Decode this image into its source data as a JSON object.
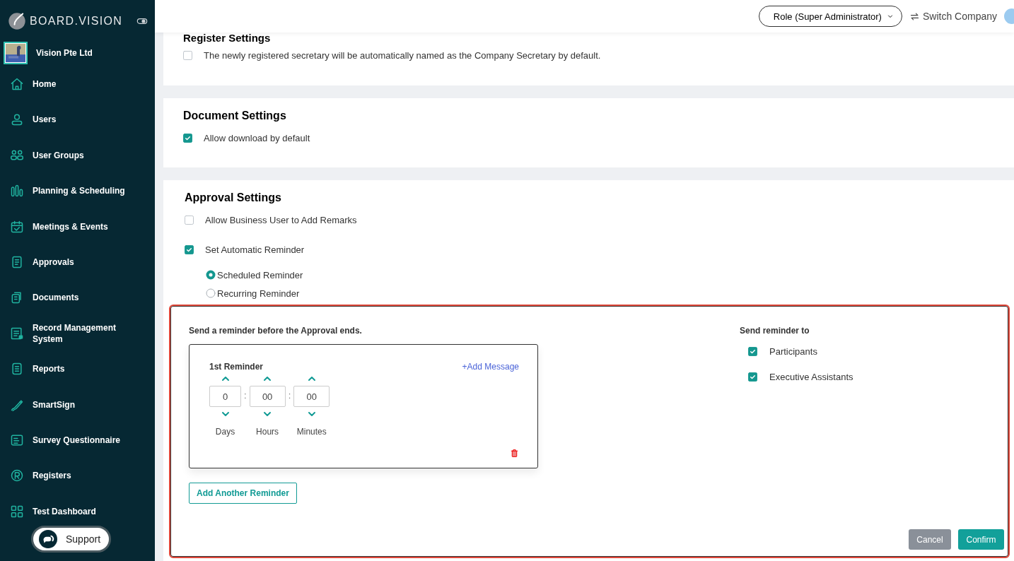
{
  "sidebar": {
    "logo": "BOARD.VISION",
    "company": "Vision Pte Ltd",
    "items": [
      {
        "label": "Home"
      },
      {
        "label": "Users"
      },
      {
        "label": "User Groups"
      },
      {
        "label": "Planning & Scheduling"
      },
      {
        "label": "Meetings & Events"
      },
      {
        "label": "Approvals"
      },
      {
        "label": "Documents"
      },
      {
        "label": "Record Management System"
      },
      {
        "label": "Reports"
      },
      {
        "label": "SmartSign"
      },
      {
        "label": "Survey Questionnaire"
      },
      {
        "label": "Registers"
      },
      {
        "label": "Test Dashboard"
      }
    ],
    "support": "Support"
  },
  "header": {
    "role": "Role (Super Administrator)",
    "switch_company": "Switch Company"
  },
  "sections": [
    {
      "title": "Register Settings",
      "options": [
        {
          "label": "The newly registered secretary will be automatically named as the Company Secretary by default.",
          "checked": false
        }
      ]
    },
    {
      "title": "Document Settings",
      "options": [
        {
          "label": "Allow download by default",
          "checked": true
        }
      ]
    },
    {
      "title": "Approval Settings",
      "options": [
        {
          "label": "Allow Business User to Add Remarks",
          "checked": false
        },
        {
          "label": "Set Automatic Reminder",
          "checked": true
        }
      ],
      "radios": [
        {
          "label": "Scheduled Reminder",
          "selected": true
        },
        {
          "label": "Recurring Reminder",
          "selected": false
        }
      ],
      "reminder_panel": {
        "heading": "Send a reminder before the Approval ends.",
        "reminders": [
          {
            "title": "1st Reminder",
            "add_message": "+Add Message",
            "separator": ":",
            "fields": [
              {
                "value": "0",
                "unit": "Days"
              },
              {
                "value": "00",
                "unit": "Hours"
              },
              {
                "value": "00",
                "unit": "Minutes"
              }
            ]
          }
        ],
        "add_button": "Add Another Reminder",
        "recipients_title": "Send reminder to",
        "recipients": [
          {
            "label": "Participants",
            "checked": true
          },
          {
            "label": "Executive Assistants",
            "checked": true
          }
        ],
        "cancel": "Cancel",
        "confirm": "Confirm"
      }
    }
  ]
}
